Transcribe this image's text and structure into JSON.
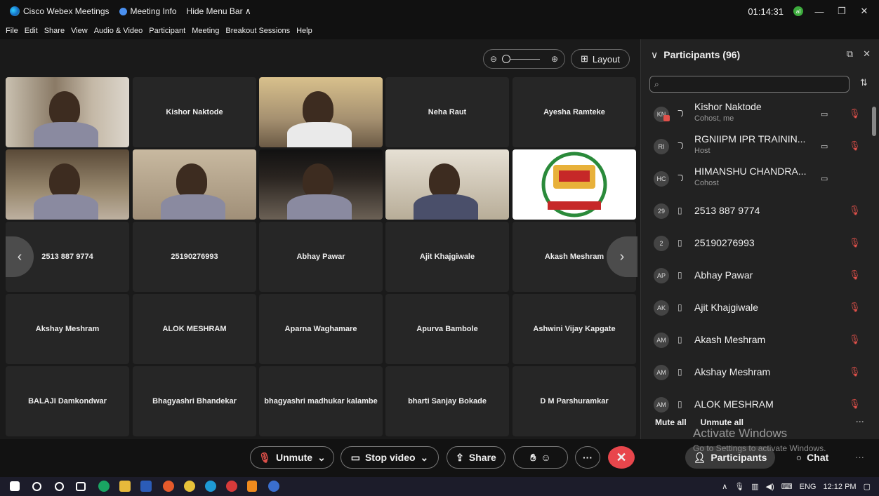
{
  "titlebar": {
    "app_title": "Cisco Webex Meetings",
    "meeting_info": "Meeting Info",
    "hide_menu": "Hide Menu Bar ∧",
    "clock": "01:14:31",
    "avatar_initial": "al"
  },
  "menu": [
    "File",
    "Edit",
    "Share",
    "View",
    "Audio & Video",
    "Participant",
    "Meeting",
    "Breakout Sessions",
    "Help"
  ],
  "stage": {
    "layout_label": "Layout",
    "zoom_out_icon": "zoom-out-icon",
    "zoom_in_icon": "zoom-in-icon",
    "tiles": [
      {
        "name": "",
        "video": true
      },
      {
        "name": "Kishor Naktode",
        "video": false
      },
      {
        "name": "",
        "video": true
      },
      {
        "name": "Neha Raut",
        "video": false
      },
      {
        "name": "Ayesha Ramteke",
        "video": false
      },
      {
        "name": "",
        "video": true
      },
      {
        "name": "",
        "video": true
      },
      {
        "name": "",
        "video": true
      },
      {
        "name": "",
        "video": true
      },
      {
        "name": "",
        "video": true,
        "logo": true
      },
      {
        "name": "2513 887 9774",
        "video": false
      },
      {
        "name": "25190276993",
        "video": false
      },
      {
        "name": "Abhay Pawar",
        "video": false
      },
      {
        "name": "Ajit Khajgiwale",
        "video": false
      },
      {
        "name": "Akash Meshram",
        "video": false
      },
      {
        "name": "Akshay Meshram",
        "video": false
      },
      {
        "name": "ALOK MESHRAM",
        "video": false
      },
      {
        "name": "Aparna Waghamare",
        "video": false
      },
      {
        "name": "Apurva Bambole",
        "video": false
      },
      {
        "name": "Ashwini Vijay Kapgate",
        "video": false
      },
      {
        "name": "BALAJI Damkondwar",
        "video": false
      },
      {
        "name": "Bhagyashri Bhandekar",
        "video": false
      },
      {
        "name": "bhagyashri madhukar kalambe",
        "video": false
      },
      {
        "name": "bharti Sanjay Bokade",
        "video": false
      },
      {
        "name": "D M Parshuramkar",
        "video": false
      }
    ]
  },
  "panel": {
    "title": "Participants (96)",
    "search_placeholder": "",
    "participants": [
      {
        "initials": "KN",
        "name": "Kishor Naktode",
        "sub": "Cohost, me",
        "device": "headset",
        "video": true,
        "muted": true
      },
      {
        "initials": "RI",
        "name": "RGNIIPM IPR TRAININ...",
        "sub": "Host",
        "device": "headset",
        "video": true,
        "muted": true
      },
      {
        "initials": "HC",
        "name": "HIMANSHU CHANDRA...",
        "sub": "Cohost",
        "device": "headset",
        "video": true,
        "muted": false
      },
      {
        "initials": "29",
        "name": "2513 887 9774",
        "sub": "",
        "device": "phone",
        "video": false,
        "muted": true
      },
      {
        "initials": "2",
        "name": "25190276993",
        "sub": "",
        "device": "phone",
        "video": false,
        "muted": true
      },
      {
        "initials": "AP",
        "name": "Abhay Pawar",
        "sub": "",
        "device": "phone",
        "video": false,
        "muted": true
      },
      {
        "initials": "AK",
        "name": "Ajit Khajgiwale",
        "sub": "",
        "device": "phone",
        "video": false,
        "muted": true
      },
      {
        "initials": "AM",
        "name": "Akash Meshram",
        "sub": "",
        "device": "phone",
        "video": false,
        "muted": true
      },
      {
        "initials": "AM",
        "name": "Akshay Meshram",
        "sub": "",
        "device": "phone",
        "video": false,
        "muted": true
      },
      {
        "initials": "AM",
        "name": "ALOK MESHRAM",
        "sub": "",
        "device": "phone",
        "video": false,
        "muted": true
      }
    ],
    "mute_all": "Mute all",
    "unmute_all": "Unmute all"
  },
  "controls": {
    "unmute": "Unmute",
    "stop_video": "Stop video",
    "share": "Share",
    "participants": "Participants",
    "chat": "Chat"
  },
  "watermark": {
    "line1": "Activate Windows",
    "line2": "Go to Settings to activate Windows."
  },
  "taskbar": {
    "lang": "ENG",
    "time": "12:12 PM"
  },
  "colors": {
    "end_call": "#e8464c",
    "muted": "#e0504a",
    "accent": "#4a90f0"
  }
}
